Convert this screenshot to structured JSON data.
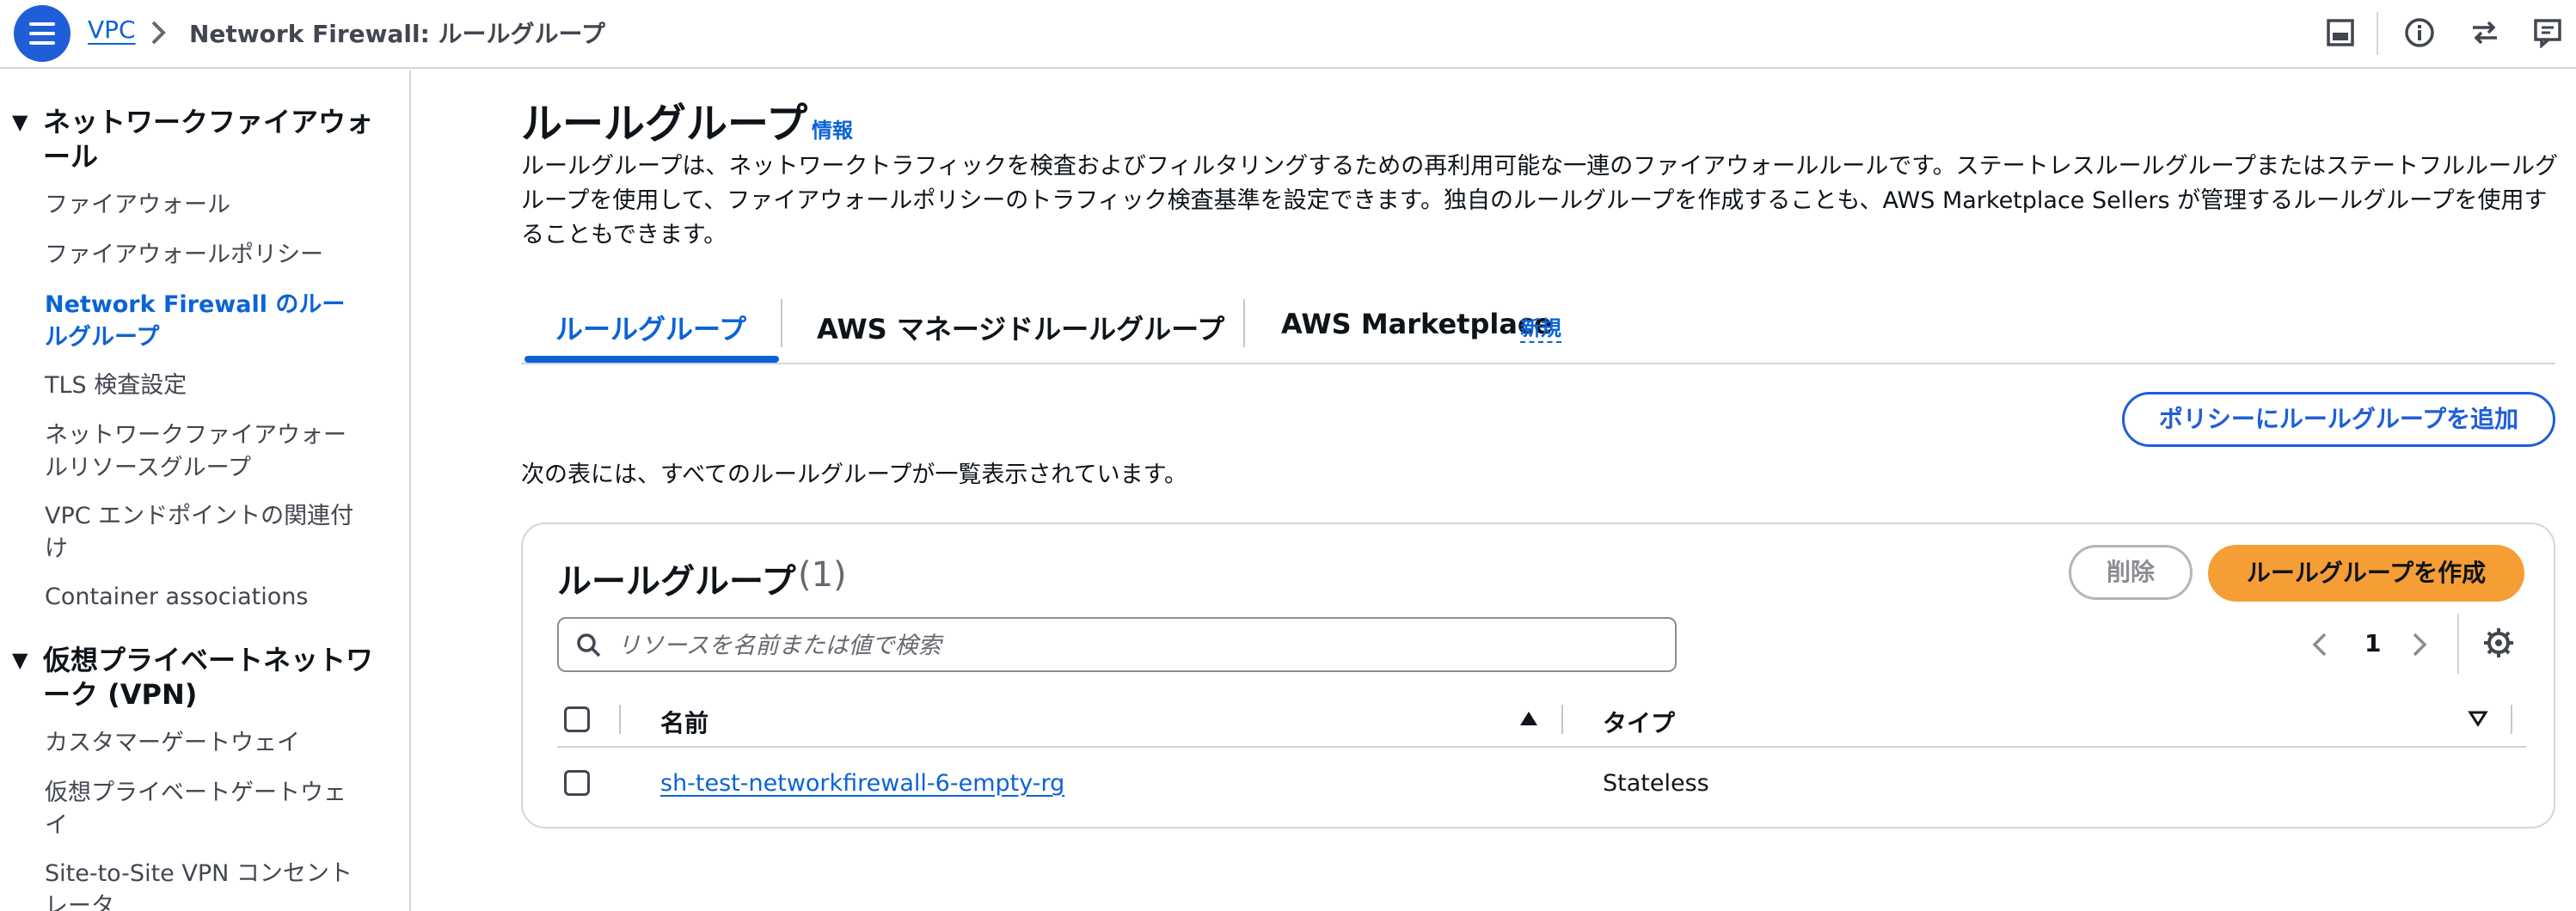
{
  "header": {
    "breadcrumb": [
      {
        "label": "VPC"
      },
      {
        "label": "Network Firewall: ルールグループ"
      }
    ],
    "icons": [
      "menu-icon",
      "panel-icon",
      "info-icon",
      "sync-icon",
      "feedback-icon"
    ]
  },
  "sidebar": {
    "cut_item": "",
    "sections": [
      {
        "title": "ネットワークファイアウォール",
        "items": [
          {
            "label": "ファイアウォール"
          },
          {
            "label": "ファイアウォールポリシー"
          },
          {
            "label": "Network Firewall のルールグループ",
            "active": true
          },
          {
            "label": "TLS 検査設定"
          },
          {
            "label": "ネットワークファイアウォールリソースグループ"
          },
          {
            "label": "VPC エンドポイントの関連付け"
          },
          {
            "label": "Container associations"
          }
        ]
      },
      {
        "title": "仮想プライベートネットワーク (VPN)",
        "items": [
          {
            "label": "カスタマーゲートウェイ"
          },
          {
            "label": "仮想プライベートゲートウェイ"
          },
          {
            "label": "Site-to-Site VPN コンセントレータ"
          }
        ]
      }
    ]
  },
  "main": {
    "title": "ルールグループ",
    "info": "情報",
    "description": "ルールグループは、ネットワークトラフィックを検査およびフィルタリングするための再利用可能な一連のファイアウォールルールです。ステートレスルールグループまたはステートフルルールグループを使用して、ファイアウォールポリシーのトラフィック検査基準を設定できます。独自のルールグループを作成することも、AWS Marketplace Sellers が管理するルールグループを使用することもできます。",
    "tabs": [
      {
        "label": "ルールグループ",
        "active": true
      },
      {
        "label": "AWS マネージドルールグループ"
      },
      {
        "label": "AWS Marketplace",
        "badge": "新規"
      }
    ],
    "add_to_policy": "ポリシーにルールグループを追加",
    "table_note": "次の表には、すべてのルールグループが一覧表示されています。"
  },
  "table": {
    "title": "ルールグループ",
    "count": "(1)",
    "delete_label": "削除",
    "create_label": "ルールグループを作成",
    "search_placeholder": "リソースを名前または値で検索",
    "page": "1",
    "columns": [
      {
        "label": "名前",
        "sort": "ascending"
      },
      {
        "label": "タイプ",
        "sort": "none"
      }
    ],
    "rows": [
      {
        "name": "sh-test-networkfirewall-6-empty-rg",
        "type": "Stateless"
      }
    ]
  },
  "colors": {
    "primary": "#1f5ed8",
    "link": "#0b63d6",
    "create_button": "#f59e35",
    "border": "#d1d5db"
  }
}
